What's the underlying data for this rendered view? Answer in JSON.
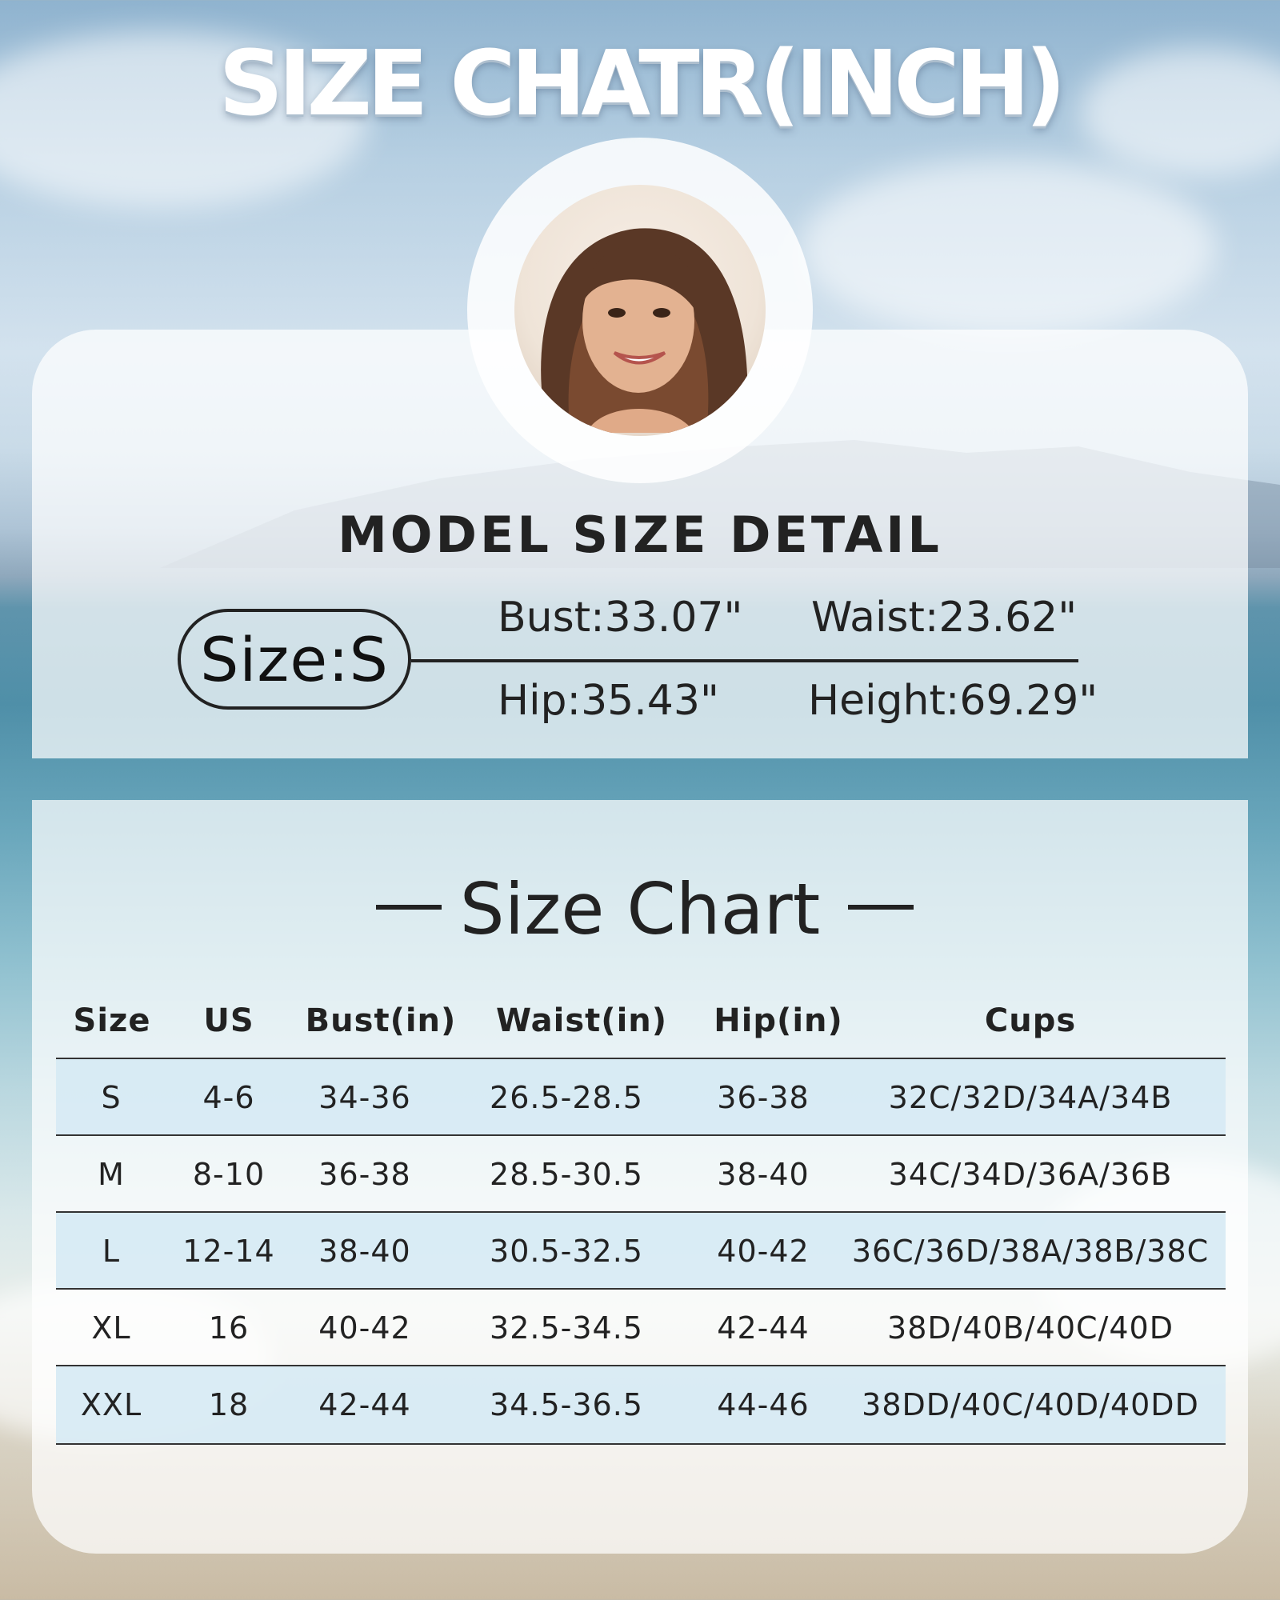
{
  "title": "SIZE CHATR(INCH)",
  "model": {
    "heading": "MODEL SIZE DETAIL",
    "size_label": "Size:S",
    "bust": "Bust:33.07\"",
    "waist": "Waist:23.62\"",
    "hip": "Hip:35.43\"",
    "height": "Height:69.29\""
  },
  "chart": {
    "heading": "Size Chart",
    "columns": [
      "Size",
      "US",
      "Bust(in)",
      "Waist(in)",
      "Hip(in)",
      "Cups"
    ],
    "rows": [
      [
        "S",
        "4-6",
        "34-36",
        "26.5-28.5",
        "36-38",
        "32C/32D/34A/34B"
      ],
      [
        "M",
        "8-10",
        "36-38",
        "28.5-30.5",
        "38-40",
        "34C/34D/36A/36B"
      ],
      [
        "L",
        "12-14",
        "38-40",
        "30.5-32.5",
        "40-42",
        "36C/36D/38A/38B/38C"
      ],
      [
        "XL",
        "16",
        "40-42",
        "32.5-34.5",
        "42-44",
        "38D/40B/40C/40D"
      ],
      [
        "XXL",
        "18",
        "42-44",
        "34.5-36.5",
        "44-46",
        "38DD/40C/40D/40DD"
      ]
    ]
  },
  "colors": {
    "row_shade": "#d6eaf4",
    "text": "#222222",
    "panel": "#ffffff"
  }
}
